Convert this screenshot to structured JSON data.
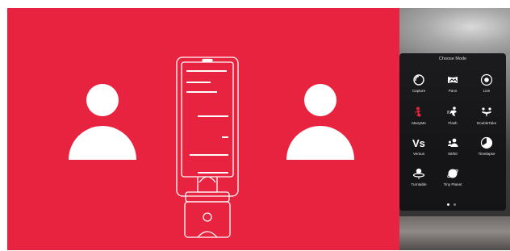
{
  "mode_menu": {
    "title": "Choose Mode",
    "modes": [
      {
        "label": "Capture",
        "icon": "capture-icon"
      },
      {
        "label": "Pano",
        "icon": "pano-icon"
      },
      {
        "label": "Live",
        "icon": "live-icon"
      },
      {
        "label": "ManyMe",
        "icon": "manyme-icon"
      },
      {
        "label": "Flash",
        "icon": "flash-icon"
      },
      {
        "label": "DoubleTake",
        "icon": "doubletake-icon"
      },
      {
        "label": "Versus",
        "icon": "versus-icon"
      },
      {
        "label": "50/50",
        "icon": "fifty-fifty-icon"
      },
      {
        "label": "Timelapse",
        "icon": "timelapse-icon"
      },
      {
        "label": "Turntable",
        "icon": "turntable-icon"
      },
      {
        "label": "Tiny Planet",
        "icon": "tiny-planet-icon"
      }
    ],
    "pagination": {
      "pages": 2,
      "current": 1
    }
  },
  "illustration": {
    "background_color": "#e8233f",
    "foreground_color": "#ffffff",
    "elements": [
      "person-left-icon",
      "phone-on-gimbal-illustration",
      "person-right-icon"
    ]
  },
  "colors": {
    "accent": "#e8233f",
    "sheet_background": "#121214",
    "manyme_icon": "#e8233f"
  }
}
